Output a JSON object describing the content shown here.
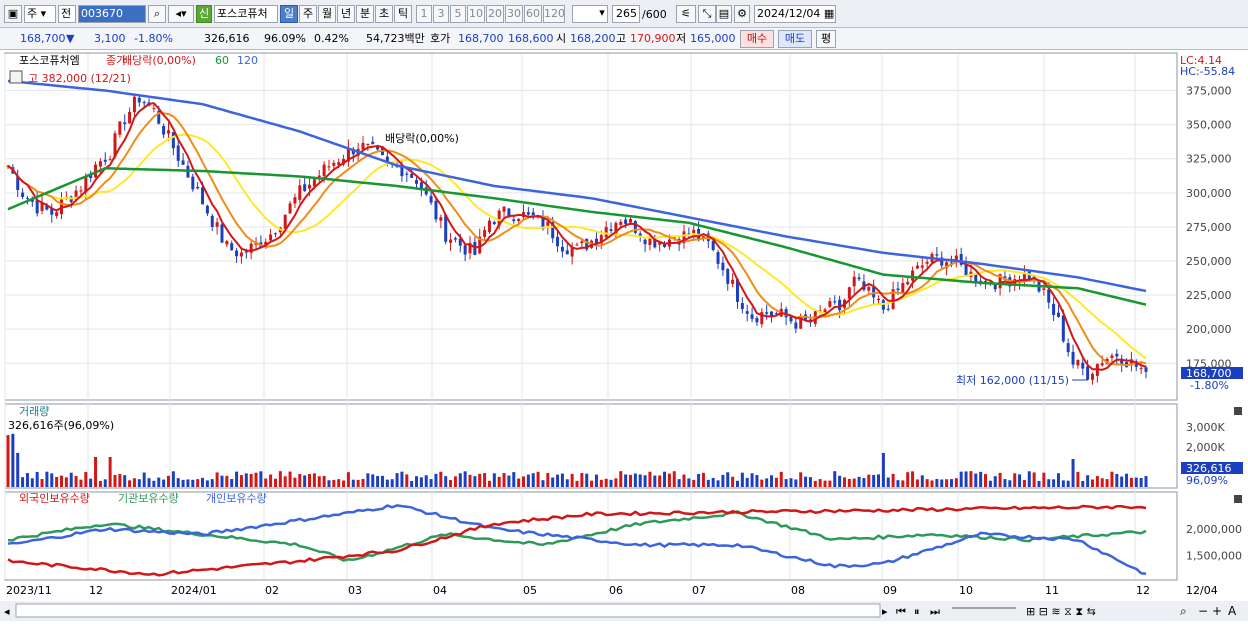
{
  "toolbar": {
    "period_type": "주",
    "search_prefix": "전",
    "stock_code": "003670",
    "signal_label": "신",
    "stock_name": "포스코퓨처",
    "period_tabs": [
      "일",
      "주",
      "월",
      "년",
      "분",
      "초",
      "틱"
    ],
    "active_period": "일",
    "minute_options": [
      "1",
      "3",
      "5",
      "10",
      "20",
      "30",
      "60",
      "120"
    ],
    "minute_input": "",
    "view_count": "265",
    "view_total": "/600",
    "date": "2024/12/04"
  },
  "quote": {
    "price": "168,700",
    "down_arrow": "▼",
    "change": "3,100",
    "change_pct": "-1.80%",
    "volume": "326,616",
    "volume_ratio": "96.09%",
    "turnover_pct": "0.42%",
    "amount": "54,723백만",
    "ask_label": "호가",
    "ask1": "168,700",
    "ask2": "168,600",
    "open_label": "시",
    "open": "168,200",
    "high_label": "고",
    "high": "170,900",
    "low_label": "저",
    "low": "165,000",
    "buy_label": "매수",
    "sell_label": "매도",
    "avg_label": "평"
  },
  "chart_legend": {
    "name": "포스코퓨처엠",
    "close_label": "종가",
    "dividend_overlay": "배당락(0,00%)",
    "ma_60": "60",
    "ma_120": "120",
    "lc": "LC:4.14",
    "hc": "HC:-55.84",
    "high_marker": "고 382,000 (12/21)",
    "dividend_marker": "배당락(0,00%)",
    "low_marker": "최저 162,000 (11/15)",
    "current_price_tag": "168,700",
    "current_pct_tag": "-1.80%",
    "volume_title": "거래량",
    "volume_info": "326,616주(96,09%)",
    "volume_tag": "326,616",
    "volume_pct_tag": "96,09%",
    "holdings": [
      "외국인보유수량",
      "기관보유수량",
      "개인보유수량"
    ]
  },
  "price_axis_labels": [
    "375,000",
    "350,000",
    "325,000",
    "300,000",
    "275,000",
    "250,000",
    "225,000",
    "200,000",
    "175,000"
  ],
  "volume_axis_labels": [
    "3,000K",
    "2,000K",
    "1,000K"
  ],
  "holding_axis_labels": [
    "2,000,000",
    "1,500,000"
  ],
  "x_axis_labels": [
    "2023/11",
    "12",
    "2024/01",
    "02",
    "03",
    "04",
    "05",
    "06",
    "07",
    "08",
    "09",
    "10",
    "11",
    "12",
    "12/04"
  ],
  "colors": {
    "up": "#d01818",
    "down": "#1b3fbf",
    "ma5": "#d01818",
    "ma10": "#f08c1a",
    "ma20": "#ffe82a",
    "ma60": "#189632",
    "ma120": "#3c64dc",
    "foreign": "#d01818",
    "institution": "#2e9a5a",
    "individual": "#3c64dc"
  },
  "chart_data": {
    "type": "candlestick",
    "x": [
      "2023/11",
      "12",
      "2024/01",
      "02",
      "03",
      "04",
      "05",
      "06",
      "07",
      "08",
      "09",
      "10",
      "11",
      "12"
    ],
    "price_ylim": [
      162000,
      382000
    ],
    "price_path": [
      [
        0,
        320000
      ],
      [
        3,
        300000
      ],
      [
        6,
        290000
      ],
      [
        9,
        285000
      ],
      [
        12,
        295000
      ],
      [
        15,
        305000
      ],
      [
        18,
        320000
      ],
      [
        21,
        330000
      ],
      [
        24,
        355000
      ],
      [
        27,
        370000
      ],
      [
        30,
        360000
      ],
      [
        33,
        340000
      ],
      [
        36,
        320000
      ],
      [
        39,
        300000
      ],
      [
        42,
        280000
      ],
      [
        45,
        260000
      ],
      [
        48,
        255000
      ],
      [
        51,
        262000
      ],
      [
        54,
        270000
      ],
      [
        57,
        285000
      ],
      [
        60,
        300000
      ],
      [
        63,
        310000
      ],
      [
        66,
        320000
      ],
      [
        69,
        328000
      ],
      [
        72,
        335000
      ],
      [
        75,
        330000
      ],
      [
        78,
        320000
      ],
      [
        81,
        318000
      ],
      [
        84,
        310000
      ],
      [
        87,
        290000
      ],
      [
        90,
        270000
      ],
      [
        93,
        262000
      ],
      [
        96,
        255000
      ],
      [
        99,
        280000
      ],
      [
        102,
        285000
      ],
      [
        105,
        285000
      ],
      [
        108,
        280000
      ],
      [
        111,
        275000
      ],
      [
        114,
        262000
      ],
      [
        117,
        258000
      ],
      [
        120,
        265000
      ],
      [
        123,
        275000
      ],
      [
        126,
        282000
      ],
      [
        129,
        275000
      ],
      [
        132,
        265000
      ],
      [
        135,
        265000
      ],
      [
        138,
        268000
      ],
      [
        141,
        270000
      ],
      [
        144,
        262000
      ],
      [
        147,
        245000
      ],
      [
        150,
        225000
      ],
      [
        153,
        210000
      ],
      [
        156,
        212000
      ],
      [
        159,
        210000
      ],
      [
        162,
        205000
      ],
      [
        165,
        205000
      ],
      [
        168,
        215000
      ],
      [
        171,
        215000
      ],
      [
        174,
        235000
      ],
      [
        177,
        225000
      ],
      [
        180,
        215000
      ],
      [
        183,
        228000
      ],
      [
        186,
        240000
      ],
      [
        189,
        250000
      ],
      [
        192,
        252000
      ],
      [
        195,
        248000
      ],
      [
        198,
        240000
      ],
      [
        201,
        235000
      ],
      [
        204,
        235000
      ],
      [
        207,
        238000
      ],
      [
        210,
        240000
      ],
      [
        213,
        225000
      ],
      [
        216,
        205000
      ],
      [
        219,
        175000
      ],
      [
        222,
        168000
      ],
      [
        225,
        178000
      ],
      [
        228,
        182000
      ],
      [
        231,
        175000
      ],
      [
        234,
        168700
      ]
    ],
    "ma60": [
      [
        0,
        288000
      ],
      [
        20,
        318000
      ],
      [
        40,
        316000
      ],
      [
        60,
        312000
      ],
      [
        80,
        305000
      ],
      [
        100,
        296000
      ],
      [
        120,
        286000
      ],
      [
        140,
        278000
      ],
      [
        160,
        260000
      ],
      [
        180,
        240000
      ],
      [
        200,
        234000
      ],
      [
        220,
        230000
      ],
      [
        234,
        218000
      ]
    ],
    "ma120": [
      [
        0,
        382000
      ],
      [
        20,
        375000
      ],
      [
        40,
        365000
      ],
      [
        60,
        345000
      ],
      [
        80,
        320000
      ],
      [
        100,
        305000
      ],
      [
        120,
        296000
      ],
      [
        140,
        282000
      ],
      [
        160,
        268000
      ],
      [
        180,
        256000
      ],
      [
        200,
        248000
      ],
      [
        220,
        238000
      ],
      [
        234,
        228000
      ]
    ],
    "volume_ylim": [
      0,
      3500000
    ],
    "holding_ylim": [
      1100000,
      2600000
    ],
    "series_names": [
      "외국인보유수량",
      "기관보유수량",
      "개인보유수량"
    ],
    "foreign": [
      [
        0,
        1400000
      ],
      [
        30,
        1150000
      ],
      [
        60,
        1400000
      ],
      [
        80,
        1600000
      ],
      [
        100,
        2100000
      ],
      [
        120,
        2280000
      ],
      [
        150,
        2320000
      ],
      [
        180,
        2350000
      ],
      [
        200,
        2380000
      ],
      [
        234,
        2420000
      ]
    ],
    "institution": [
      [
        0,
        1800000
      ],
      [
        20,
        2100000
      ],
      [
        40,
        1900000
      ],
      [
        60,
        1700000
      ],
      [
        70,
        1400000
      ],
      [
        90,
        1900000
      ],
      [
        110,
        1700000
      ],
      [
        130,
        2100000
      ],
      [
        150,
        2300000
      ],
      [
        170,
        1800000
      ],
      [
        190,
        1900000
      ],
      [
        210,
        1800000
      ],
      [
        234,
        1950000
      ]
    ],
    "individual": [
      [
        0,
        1700000
      ],
      [
        20,
        2000000
      ],
      [
        40,
        1900000
      ],
      [
        70,
        2300000
      ],
      [
        80,
        2450000
      ],
      [
        100,
        2000000
      ],
      [
        130,
        1700000
      ],
      [
        150,
        1700000
      ],
      [
        170,
        1300000
      ],
      [
        180,
        1350000
      ],
      [
        200,
        1900000
      ],
      [
        220,
        1800000
      ],
      [
        234,
        1150000
      ]
    ]
  }
}
